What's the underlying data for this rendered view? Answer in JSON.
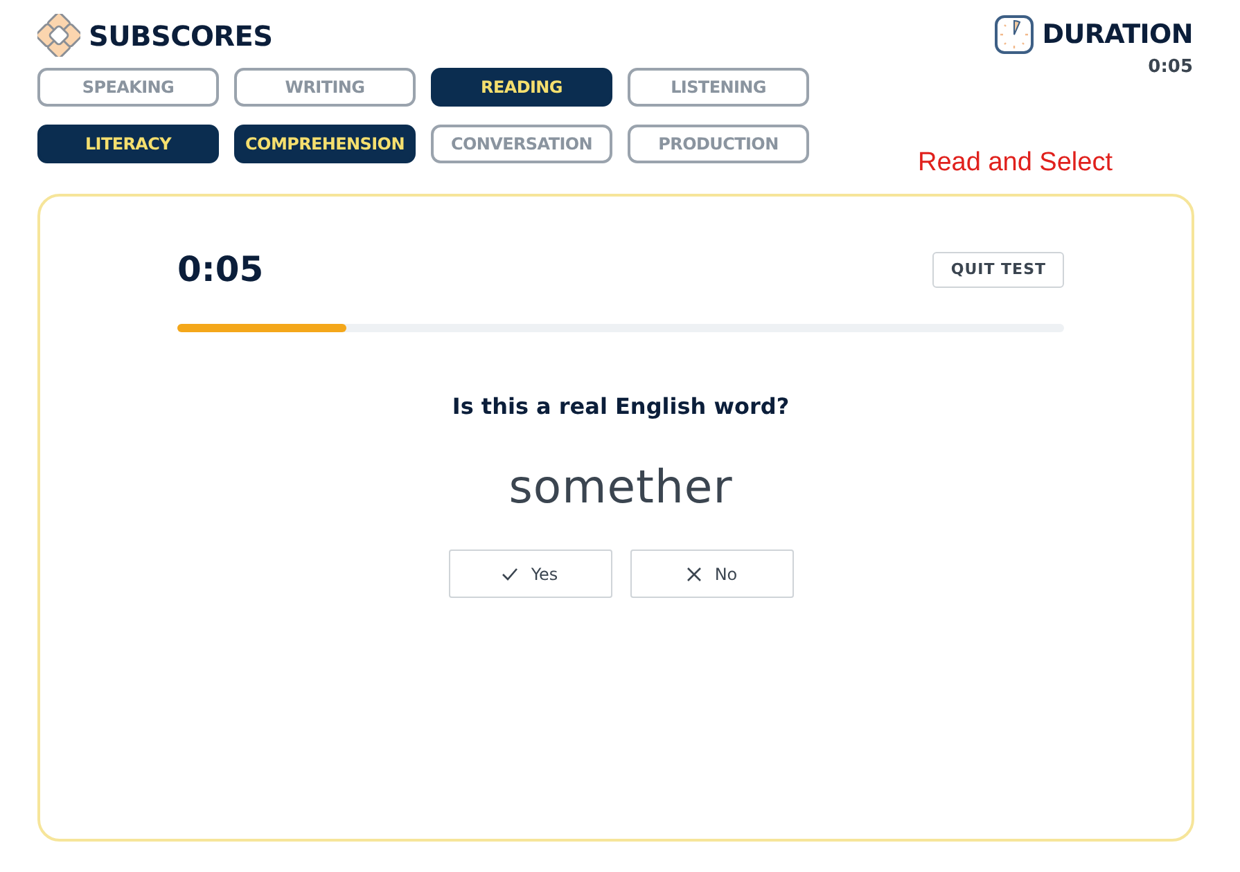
{
  "subscores": {
    "title": "SUBSCORES",
    "chips": [
      {
        "label": "SPEAKING",
        "selected": false
      },
      {
        "label": "WRITING",
        "selected": false
      },
      {
        "label": "READING",
        "selected": true
      },
      {
        "label": "LISTENING",
        "selected": false
      },
      {
        "label": "LITERACY",
        "selected": true
      },
      {
        "label": "COMPREHENSION",
        "selected": true
      },
      {
        "label": "CONVERSATION",
        "selected": false
      },
      {
        "label": "PRODUCTION",
        "selected": false
      }
    ]
  },
  "duration": {
    "title": "DURATION",
    "value": "0:05"
  },
  "task_label": "Read and Select",
  "quiz": {
    "timer": "0:05",
    "quit": "QUIT TEST",
    "level": 0.19,
    "question": "Is this a real English word?",
    "word": "somether",
    "answers": [
      {
        "label": "Yes",
        "kind": "check"
      },
      {
        "label": "No",
        "kind": "cross"
      }
    ]
  }
}
